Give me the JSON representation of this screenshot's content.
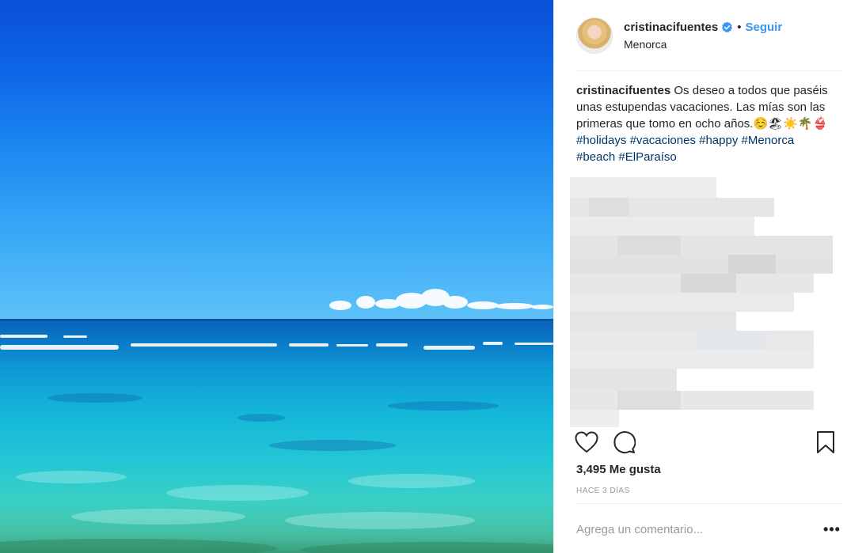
{
  "post": {
    "username": "cristinacifuentes",
    "follow_label": "Seguir",
    "separator": "•",
    "location": "Menorca",
    "caption": {
      "username": "cristinacifuentes",
      "text": " Os deseo a todos que paséis unas estupendas vacaciones. Las mías son las primeras que tomo en ocho años.☺️🏖☀️🌴👙 ",
      "hashtags": [
        "#holidays",
        "#vacaciones",
        "#happy",
        "#Menorca",
        "#beach",
        "#ElParaíso"
      ]
    },
    "likes": "3,495 Me gusta",
    "time": "HACE 3 DÍAS",
    "comment_placeholder": "Agrega un comentario...",
    "more_label": "•••"
  },
  "icons": {
    "verified": "verified-badge-icon",
    "like": "heart-icon",
    "comment": "comment-bubble-icon",
    "save": "bookmark-icon",
    "more": "more-options-icon"
  },
  "colors": {
    "link_blue": "#3897f0",
    "hashtag": "#003569",
    "text": "#262626",
    "muted": "#999999"
  }
}
